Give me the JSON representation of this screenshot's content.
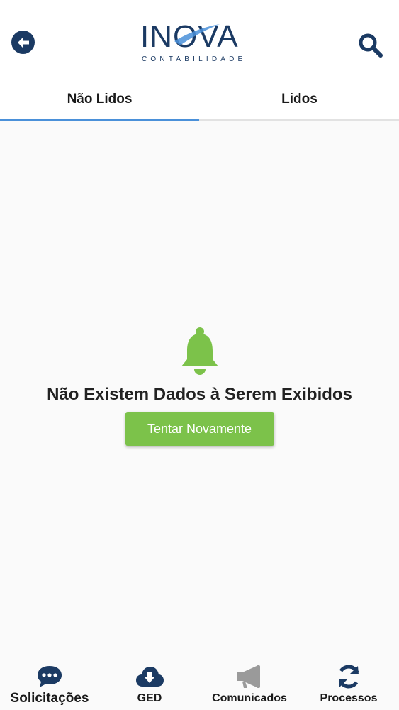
{
  "header": {
    "logo_main": "INOVA",
    "logo_sub": "CONTABILIDADE",
    "back_icon": "arrow-left-circle-icon",
    "search_icon": "search-icon"
  },
  "tabs": [
    {
      "label": "Não Lidos",
      "active": true
    },
    {
      "label": "Lidos",
      "active": false
    }
  ],
  "empty_state": {
    "icon": "bell-icon",
    "message": "Não Existem Dados à Serem Exibidos",
    "retry_label": "Tentar Novamente"
  },
  "bottom_nav": [
    {
      "label": "Solicitações",
      "icon": "chat-icon",
      "active": true
    },
    {
      "label": "GED",
      "icon": "cloud-download-icon",
      "active": false
    },
    {
      "label": "Comunicados",
      "icon": "megaphone-icon",
      "active": false
    },
    {
      "label": "Processos",
      "icon": "refresh-icon",
      "active": false
    }
  ],
  "colors": {
    "brand_navy": "#1b3a63",
    "accent_green": "#7cc24a",
    "tab_indicator": "#4a90d9",
    "inactive_icon": "#9a9a9a"
  }
}
